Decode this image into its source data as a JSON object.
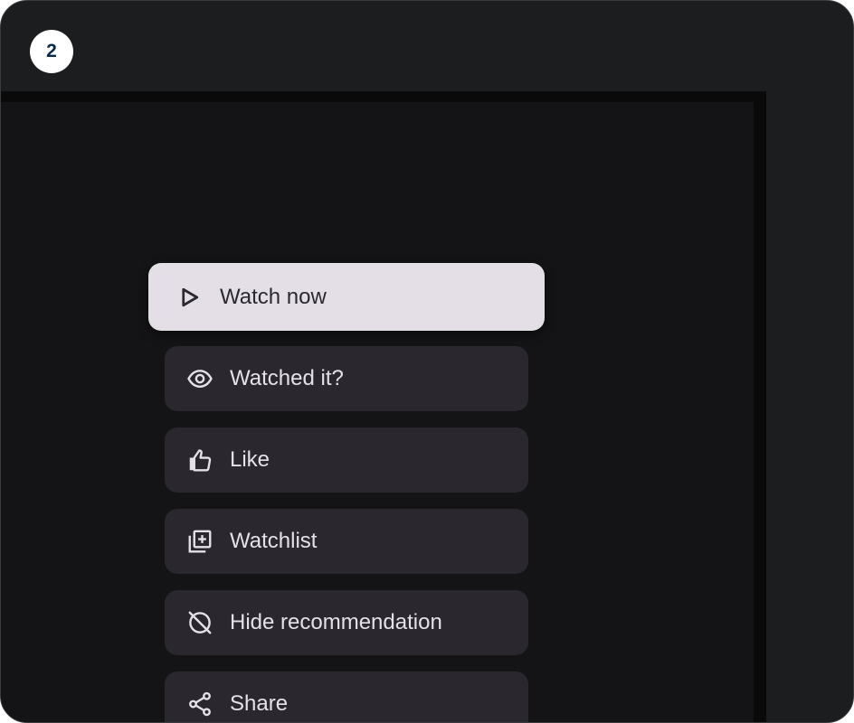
{
  "step_badge": "2",
  "menu": {
    "items": [
      {
        "label": "Watch now",
        "icon": "play-icon",
        "state": "focused"
      },
      {
        "label": "Watched it?",
        "icon": "eye-icon",
        "state": "normal"
      },
      {
        "label": "Like",
        "icon": "thumb-up-icon",
        "state": "normal"
      },
      {
        "label": "Watchlist",
        "icon": "library-add-icon",
        "state": "normal"
      },
      {
        "label": "Hide recommendation",
        "icon": "hide-icon",
        "state": "normal"
      },
      {
        "label": "Share",
        "icon": "share-icon",
        "state": "normal"
      }
    ]
  },
  "colors": {
    "frame_bg": "#1c1d1f",
    "screen_bg": "#141417",
    "item_bg": "#2a282e",
    "item_text": "#e6e1e8",
    "focused_bg": "#e4dfe6",
    "focused_text": "#2b2930"
  }
}
